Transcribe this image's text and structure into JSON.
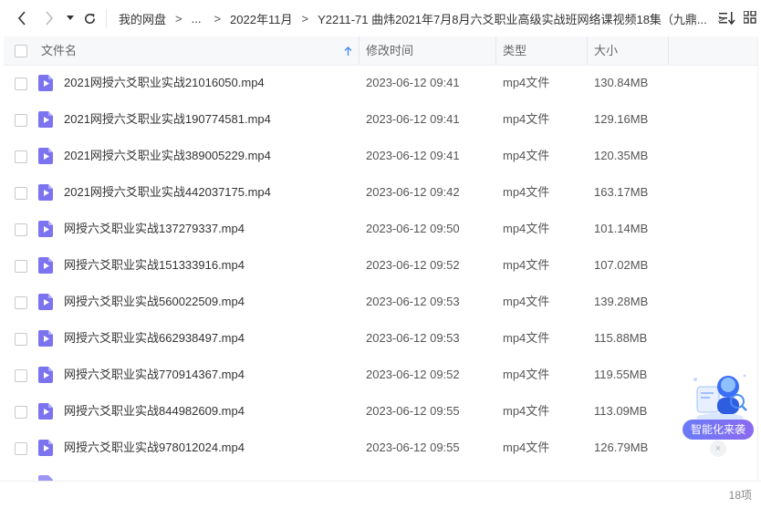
{
  "breadcrumb": {
    "items": [
      "我的网盘",
      "...",
      "2022年11月",
      "Y2211-71 曲炜2021年7月8月六爻职业高级实战班网络课视频18集（九鼎...",
      ""
    ],
    "separator": ">"
  },
  "table": {
    "headers": {
      "name": "文件名",
      "modified": "修改时间",
      "type": "类型",
      "size": "大小"
    },
    "rows": [
      {
        "name": "2021网授六爻职业实战21016050.mp4",
        "modified": "2023-06-12 09:41",
        "type": "mp4文件",
        "size": "130.84MB"
      },
      {
        "name": "2021网授六爻职业实战190774581.mp4",
        "modified": "2023-06-12 09:41",
        "type": "mp4文件",
        "size": "129.16MB"
      },
      {
        "name": "2021网授六爻职业实战389005229.mp4",
        "modified": "2023-06-12 09:41",
        "type": "mp4文件",
        "size": "120.35MB"
      },
      {
        "name": "2021网授六爻职业实战442037175.mp4",
        "modified": "2023-06-12 09:42",
        "type": "mp4文件",
        "size": "163.17MB"
      },
      {
        "name": "网授六爻职业实战137279337.mp4",
        "modified": "2023-06-12 09:50",
        "type": "mp4文件",
        "size": "101.14MB"
      },
      {
        "name": "网授六爻职业实战151333916.mp4",
        "modified": "2023-06-12 09:52",
        "type": "mp4文件",
        "size": "107.02MB"
      },
      {
        "name": "网授六爻职业实战560022509.mp4",
        "modified": "2023-06-12 09:53",
        "type": "mp4文件",
        "size": "139.28MB"
      },
      {
        "name": "网授六爻职业实战662938497.mp4",
        "modified": "2023-06-12 09:53",
        "type": "mp4文件",
        "size": "115.88MB"
      },
      {
        "name": "网授六爻职业实战770914367.mp4",
        "modified": "2023-06-12 09:52",
        "type": "mp4文件",
        "size": "119.55MB"
      },
      {
        "name": "网授六爻职业实战844982609.mp4",
        "modified": "2023-06-12 09:55",
        "type": "mp4文件",
        "size": "113.09MB"
      },
      {
        "name": "网授六爻职业实战978012024.mp4",
        "modified": "2023-06-12 09:55",
        "type": "mp4文件",
        "size": "126.79MB"
      }
    ]
  },
  "status": {
    "item_count": "18项"
  },
  "assistant": {
    "label": "智能化来袭",
    "close": "×"
  },
  "icons": {
    "back": "chevron-left-icon",
    "forward": "chevron-right-icon",
    "history": "caret-down-icon",
    "refresh": "refresh-icon",
    "sort": "sort-list-icon",
    "file": "video-file-icon"
  },
  "colors": {
    "file_icon": "#7b73f0",
    "sort_arrow": "#4a8cf7",
    "assistant_badge": "#7470f2"
  }
}
